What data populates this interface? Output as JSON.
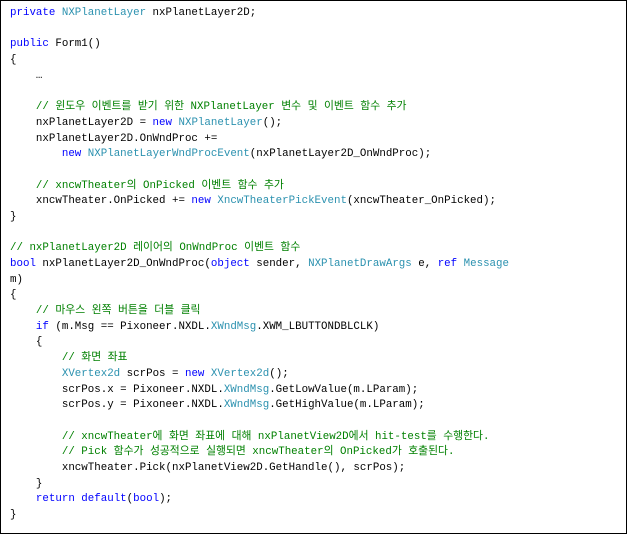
{
  "colors": {
    "keyword": "#0000ff",
    "type": "#2b91af",
    "comment": "#008000",
    "text": "#000000",
    "border": "#000000"
  },
  "lines": [
    [
      {
        "t": "private",
        "c": "kw"
      },
      {
        "t": " "
      },
      {
        "t": "NXPlanetLayer",
        "c": "ty"
      },
      {
        "t": " nxPlanetLayer2D;"
      }
    ],
    [],
    [
      {
        "t": "public",
        "c": "kw"
      },
      {
        "t": " Form1()"
      }
    ],
    [
      {
        "t": "{"
      }
    ],
    [
      {
        "t": "    …"
      }
    ],
    [],
    [
      {
        "t": "    // 윈도우 이벤트를 받기 위한 NXPlanetLayer 변수 및 이벤트 함수 추가",
        "c": "cm"
      }
    ],
    [
      {
        "t": "    nxPlanetLayer2D = "
      },
      {
        "t": "new",
        "c": "kw"
      },
      {
        "t": " "
      },
      {
        "t": "NXPlanetLayer",
        "c": "ty"
      },
      {
        "t": "();"
      }
    ],
    [
      {
        "t": "    nxPlanetLayer2D.OnWndProc +="
      }
    ],
    [
      {
        "t": "        "
      },
      {
        "t": "new",
        "c": "kw"
      },
      {
        "t": " "
      },
      {
        "t": "NXPlanetLayerWndProcEvent",
        "c": "ty"
      },
      {
        "t": "(nxPlanetLayer2D_OnWndProc);"
      }
    ],
    [],
    [
      {
        "t": "    // xncwTheater의 OnPicked 이벤트 함수 추가",
        "c": "cm"
      }
    ],
    [
      {
        "t": "    xncwTheater.OnPicked += "
      },
      {
        "t": "new",
        "c": "kw"
      },
      {
        "t": " "
      },
      {
        "t": "XncwTheaterPickEvent",
        "c": "ty"
      },
      {
        "t": "(xncwTheater_OnPicked);"
      }
    ],
    [
      {
        "t": "}"
      }
    ],
    [],
    [
      {
        "t": "// nxPlanetLayer2D 레이어의 OnWndProc 이벤트 함수",
        "c": "cm"
      }
    ],
    [
      {
        "t": "bool",
        "c": "kw"
      },
      {
        "t": " nxPlanetLayer2D_OnWndProc("
      },
      {
        "t": "object",
        "c": "kw"
      },
      {
        "t": " sender, "
      },
      {
        "t": "NXPlanetDrawArgs",
        "c": "ty"
      },
      {
        "t": " e, "
      },
      {
        "t": "ref",
        "c": "kw"
      },
      {
        "t": " "
      },
      {
        "t": "Message",
        "c": "ty"
      }
    ],
    [
      {
        "t": "m)"
      }
    ],
    [
      {
        "t": "{"
      }
    ],
    [
      {
        "t": "    // 마우스 왼쪽 버튼을 더블 클릭",
        "c": "cm"
      }
    ],
    [
      {
        "t": "    "
      },
      {
        "t": "if",
        "c": "kw"
      },
      {
        "t": " (m.Msg == Pixoneer.NXDL."
      },
      {
        "t": "XWndMsg",
        "c": "ty"
      },
      {
        "t": ".XWM_LBUTTONDBLCLK)"
      }
    ],
    [
      {
        "t": "    {"
      }
    ],
    [
      {
        "t": "        // 화면 좌표",
        "c": "cm"
      }
    ],
    [
      {
        "t": "        "
      },
      {
        "t": "XVertex2d",
        "c": "ty"
      },
      {
        "t": " scrPos = "
      },
      {
        "t": "new",
        "c": "kw"
      },
      {
        "t": " "
      },
      {
        "t": "XVertex2d",
        "c": "ty"
      },
      {
        "t": "();"
      }
    ],
    [
      {
        "t": "        scrPos.x = Pixoneer.NXDL."
      },
      {
        "t": "XWndMsg",
        "c": "ty"
      },
      {
        "t": ".GetLowValue(m.LParam);"
      }
    ],
    [
      {
        "t": "        scrPos.y = Pixoneer.NXDL."
      },
      {
        "t": "XWndMsg",
        "c": "ty"
      },
      {
        "t": ".GetHighValue(m.LParam);"
      }
    ],
    [],
    [
      {
        "t": "        // xncwTheater에 화면 좌표에 대해 nxPlanetView2D에서 hit-test를 수행한다.",
        "c": "cm"
      }
    ],
    [
      {
        "t": "        // Pick 함수가 성공적으로 실행되면 xncwTheater의 OnPicked가 호출된다.",
        "c": "cm"
      }
    ],
    [
      {
        "t": "        xncwTheater.Pick(nxPlanetView2D.GetHandle(), scrPos);"
      }
    ],
    [
      {
        "t": "    }"
      }
    ],
    [
      {
        "t": "    "
      },
      {
        "t": "return",
        "c": "kw"
      },
      {
        "t": " "
      },
      {
        "t": "default",
        "c": "kw"
      },
      {
        "t": "("
      },
      {
        "t": "bool",
        "c": "kw"
      },
      {
        "t": ");"
      }
    ],
    [
      {
        "t": "}"
      }
    ]
  ]
}
